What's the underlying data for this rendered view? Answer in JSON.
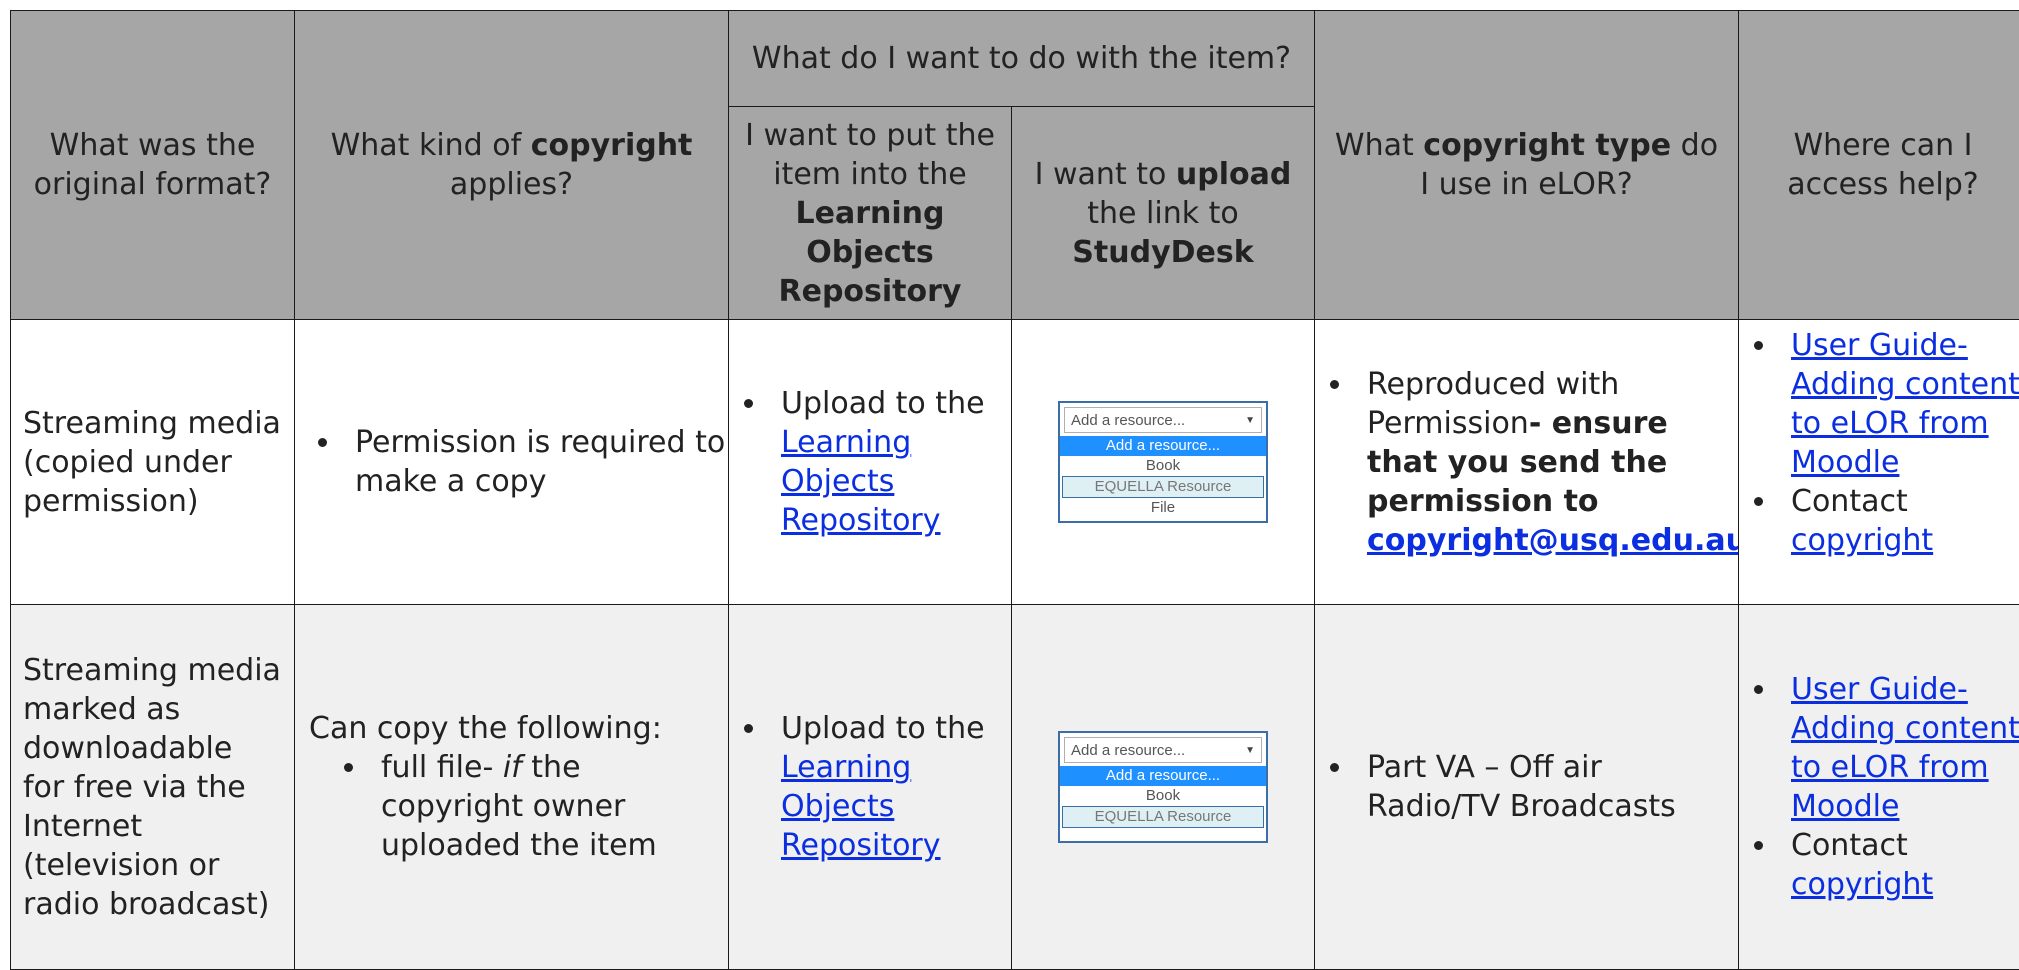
{
  "header": {
    "col1": "What was the original format?",
    "col2_pre": "What kind of ",
    "col2_bold": "copyright",
    "col2_post": " applies?",
    "group": "What do I want to do with the item?",
    "col3_pre": "I want to put the item into the ",
    "col3_bold": "Learning Objects Repository",
    "col4_pre": "I want to ",
    "col4_bold1": "upload",
    "col4_mid": " the link to ",
    "col4_bold2": "StudyDesk",
    "col5_pre": "What ",
    "col5_bold": "copyright type",
    "col5_post": " do I use in eLOR?",
    "col6": "Where can I access help?"
  },
  "rows": [
    {
      "format": "Streaming media (copied under permission)",
      "copyright_item": "Permission is required to make a copy",
      "upload_pre": "Upload to the ",
      "upload_link": "Learning Objects Repository",
      "dropdown": {
        "selected": "Add a resource...",
        "options": [
          "Add a resource...",
          "Book",
          "EQUELLA Resource",
          "File"
        ]
      },
      "type_pre": "Reproduced with Permission",
      "type_bold": "- ensure that you send the permission to",
      "type_email": "copyright@usq.edu.au",
      "help_link": "User Guide- Adding content to eLOR from Moodle",
      "help_contact": "Contact",
      "help_contact_link": "copyright"
    },
    {
      "format": "Streaming media marked as downloadable for free via the Internet (television or radio broadcast)",
      "copyright_intro": "Can copy the following:",
      "copyright_item_pre": "full file- ",
      "copyright_item_em": "if",
      "copyright_item_post": " the copyright owner uploaded the item",
      "upload_pre": "Upload to the ",
      "upload_link": "Learning Objects Repository",
      "dropdown": {
        "selected": "Add a resource...",
        "options": [
          "Add a resource...",
          "Book",
          "EQUELLA Resource"
        ]
      },
      "type_item": "Part VA – Off air Radio/TV Broadcasts",
      "help_link": "User Guide- Adding content to eLOR from Moodle",
      "help_contact": "Contact",
      "help_contact_link": "copyright"
    }
  ]
}
